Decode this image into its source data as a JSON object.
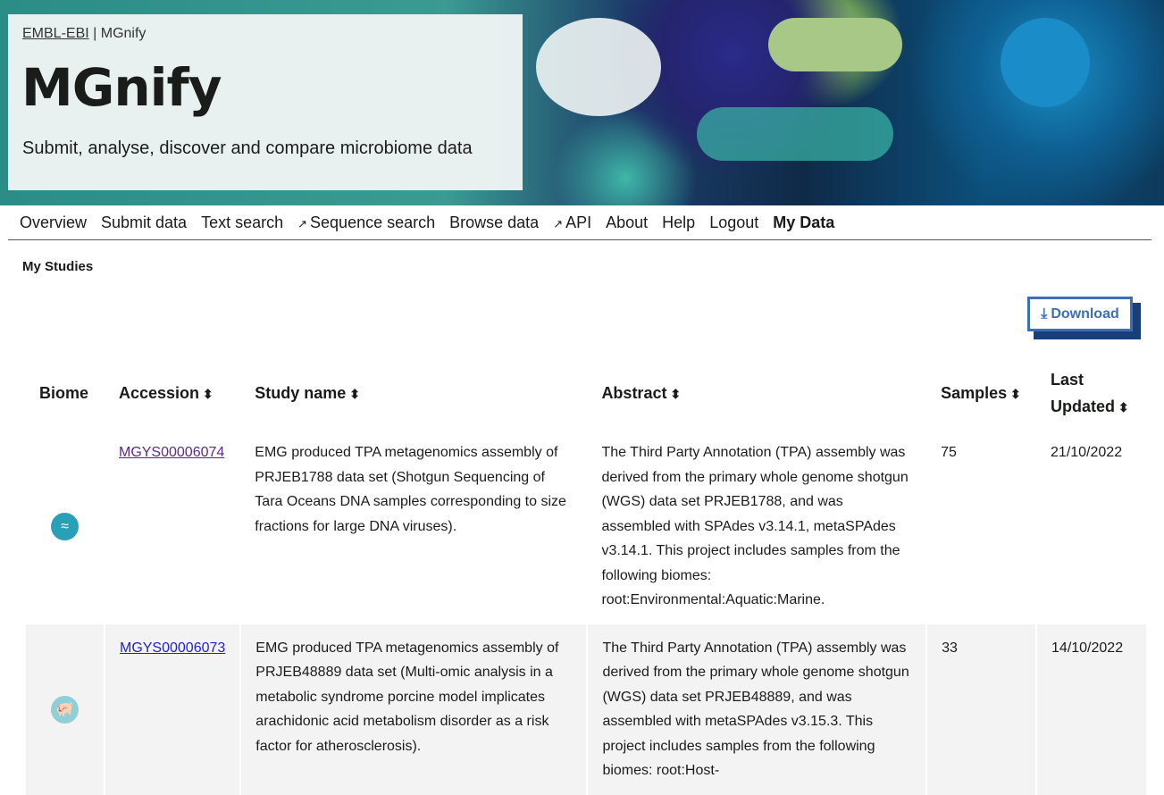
{
  "header": {
    "breadcrumb_link": "EMBL-EBI",
    "breadcrumb_sep": " | ",
    "breadcrumb_current": "MGnify",
    "logo": "MGnify",
    "tagline": "Submit, analyse, discover and compare microbiome data"
  },
  "nav": [
    {
      "label": "Overview"
    },
    {
      "label": "Submit data"
    },
    {
      "label": "Text search"
    },
    {
      "label": "Sequence search",
      "external": true
    },
    {
      "label": "Browse data"
    },
    {
      "label": "API",
      "external": true
    },
    {
      "label": "About"
    },
    {
      "label": "Help"
    },
    {
      "label": "Logout"
    },
    {
      "label": "My Data",
      "active": true
    }
  ],
  "page": {
    "title": "My Studies",
    "download_label": "Download"
  },
  "table": {
    "headers": [
      "Biome",
      "Accession",
      "Study name",
      "Abstract",
      "Samples",
      "Last Updated"
    ],
    "rows": [
      {
        "biome": "marine-icon",
        "accession": "MGYS00006074",
        "name": "EMG produced TPA metagenomics assembly of PRJEB1788 data set (Shotgun Sequencing of Tara Oceans DNA samples corresponding to size fractions for large DNA viruses).",
        "abstract": "The Third Party Annotation (TPA) assembly was derived from the primary whole genome shotgun (WGS) data set PRJEB1788, and was assembled with SPAdes v3.14.1, metaSPAdes v3.14.1. This project includes samples from the following biomes: root:Environmental:Aquatic:Marine.",
        "samples": "75",
        "updated": "21/10/2022"
      },
      {
        "biome": "pig-icon",
        "accession": "MGYS00006073",
        "name": "EMG produced TPA metagenomics assembly of PRJEB48889 data set (Multi-omic analysis in a metabolic syndrome porcine model implicates arachidonic acid metabolism disorder as a risk factor for atherosclerosis).",
        "abstract": "The Third Party Annotation (TPA) assembly was derived from the primary whole genome shotgun (WGS) data set PRJEB48889, and was assembled with metaSPAdes v3.15.3. This project includes samples from the following biomes: root:Host-",
        "samples": "33",
        "updated": "14/10/2022"
      }
    ]
  }
}
